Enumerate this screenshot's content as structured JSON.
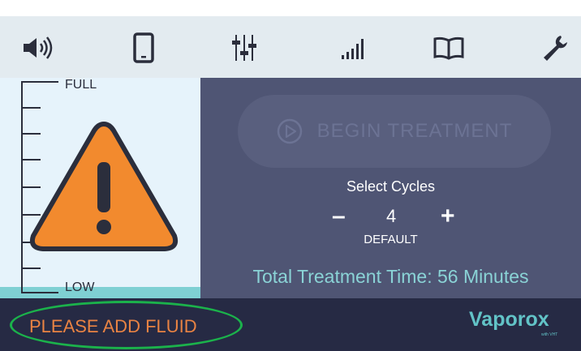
{
  "toolbar": {
    "icons": [
      "speaker-icon",
      "tablet-icon",
      "sliders-icon",
      "signal-icon",
      "book-icon",
      "wrench-icon"
    ]
  },
  "tank": {
    "full_label": "FULL",
    "low_label": "LOW",
    "alert_icon": "warning-triangle-icon"
  },
  "treatment": {
    "begin_label": "BEGIN TREATMENT",
    "begin_icon": "play-circle-icon",
    "cycles_title": "Select Cycles",
    "minus_label": "–",
    "cycles_value": "4",
    "plus_label": "+",
    "default_label": "DEFAULT",
    "total_time": "Total Treatment Time: 56 Minutes"
  },
  "status": {
    "message": "PLEASE ADD FLUID",
    "logo": "Vaporox",
    "logo_sub": "with VHT"
  },
  "colors": {
    "panel": "#4f5574",
    "statusbar": "#262a44",
    "accent": "#62c3c7",
    "warning": "#f28a2e",
    "highlight": "#1bb24b"
  }
}
